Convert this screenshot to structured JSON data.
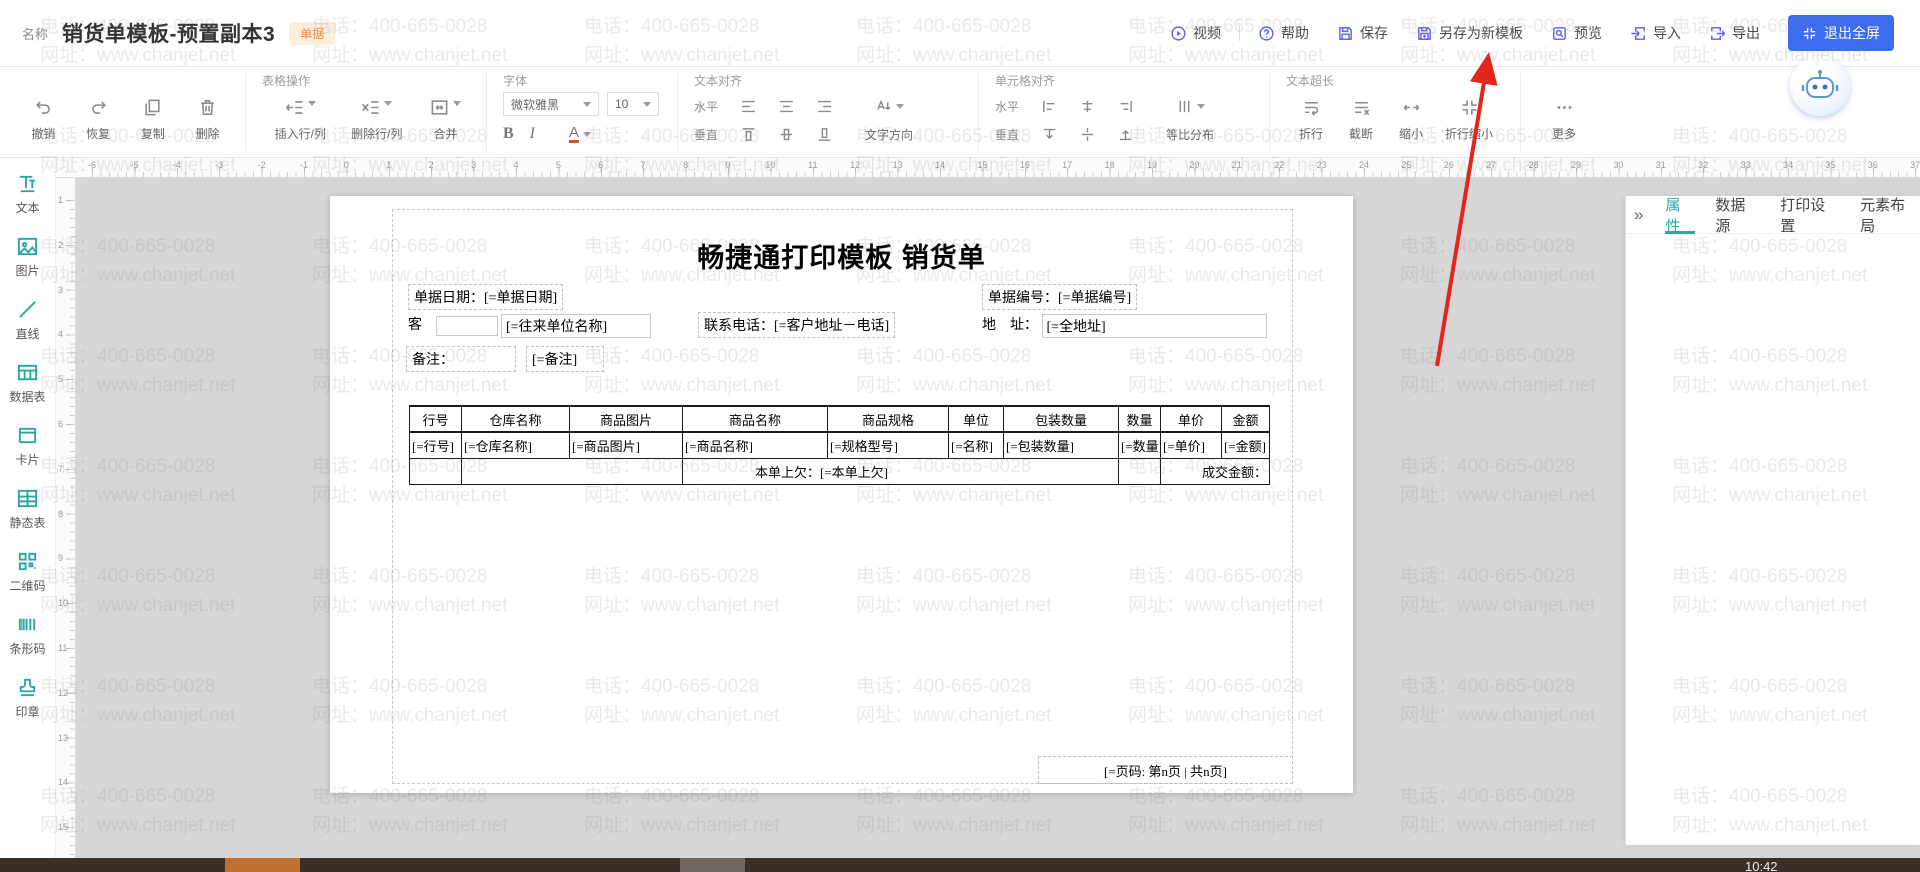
{
  "watermark": {
    "line1": "电话：400-665-0028",
    "line2": "网址：www.chanjet.net"
  },
  "colors": {
    "accent_teal": "#2aa8a0",
    "primary_blue": "#3d6cf0",
    "arrow_red": "#e1261c",
    "badge_orange": "#f08c3f",
    "taskbar_brown": "#3b2f27"
  },
  "header": {
    "name_label": "名称",
    "title": "销货单模板-预置副本3",
    "badge": "单据",
    "actions": [
      {
        "id": "video",
        "label": "视频"
      },
      {
        "id": "help",
        "label": "帮助"
      },
      {
        "id": "save",
        "label": "保存"
      },
      {
        "id": "save-as",
        "label": "另存为新模板"
      },
      {
        "id": "preview",
        "label": "预览"
      },
      {
        "id": "import",
        "label": "导入"
      },
      {
        "id": "export",
        "label": "导出"
      }
    ],
    "exit_fullscreen": "退出全屏"
  },
  "toolbar": {
    "history": {
      "undo": "撤销",
      "redo": "恢复",
      "copy": "复制",
      "delete": "删除"
    },
    "table_ops": {
      "title": "表格操作",
      "insert": "插入行/列",
      "remove": "删除行/列",
      "merge": "合并"
    },
    "font": {
      "title": "字体",
      "family": "微软雅黑",
      "size": "10",
      "bold": "B",
      "italic": "I",
      "color": "A"
    },
    "text_align": {
      "title": "文本对齐",
      "horizontal": "水平",
      "vertical": "垂直",
      "direction": "文字方向"
    },
    "cell_align": {
      "title": "单元格对齐",
      "horizontal": "水平",
      "vertical": "垂直",
      "distribute": "等比分布"
    },
    "overflow": {
      "title": "文本超长",
      "wrap": "折行",
      "truncate": "截断",
      "shrink": "缩小",
      "wrap_shrink": "折行缩小"
    },
    "more": "更多"
  },
  "toolbox": {
    "items": [
      {
        "id": "text",
        "label": "文本"
      },
      {
        "id": "image",
        "label": "图片"
      },
      {
        "id": "line",
        "label": "直线"
      },
      {
        "id": "datatable",
        "label": "数据表"
      },
      {
        "id": "card",
        "label": "卡片"
      },
      {
        "id": "statictable",
        "label": "静态表"
      },
      {
        "id": "qrcode",
        "label": "二维码"
      },
      {
        "id": "barcode",
        "label": "条形码"
      },
      {
        "id": "stamp",
        "label": "印章"
      }
    ]
  },
  "rulers": {
    "h_min": -6,
    "h_max": 37,
    "h_origin": 36,
    "h_step": 42.4,
    "v_min": 1,
    "v_max": 15,
    "v_origin": 22,
    "v_step": 44.8
  },
  "right_panel": {
    "collapse": "»",
    "tabs": [
      "属性",
      "数据源",
      "打印设置",
      "元素布局"
    ],
    "active_tab": "属性"
  },
  "template": {
    "title": "畅捷通打印模板 销货单",
    "fields": {
      "date_label": "单据日期：",
      "date_value": "[=单据日期]",
      "no_label": "单据编号：",
      "no_value": "[=单据编号]",
      "customer_label": "客",
      "customer_value": "[=往来单位名称]",
      "phone_label": "联系电话：",
      "phone_value": "[=客户地址－电话]",
      "addr_label": "地　址：",
      "addr_value": "[=全地址]",
      "remark_label": "备注：",
      "remark_value": "[=备注]"
    },
    "table": {
      "headers": [
        "行号",
        "仓库名称",
        "商品图片",
        "商品名称",
        "商品规格",
        "单位",
        "包装数量",
        "数量",
        "单价",
        "金额"
      ],
      "row": [
        "[=行号]",
        "[=仓库名称]",
        "[=商品图片]",
        "[=商品名称]",
        "[=规格型号]",
        "[=名称]",
        "[=包装数量]",
        "[=数量]",
        "[=单价]",
        "[=金额]"
      ],
      "footer_owed": "本单上欠：[=本单上欠]",
      "footer_amount": "成交金额："
    },
    "page_number": "[=页码: 第n页 | 共n页]"
  },
  "taskbar": {
    "clock": "10:42"
  }
}
